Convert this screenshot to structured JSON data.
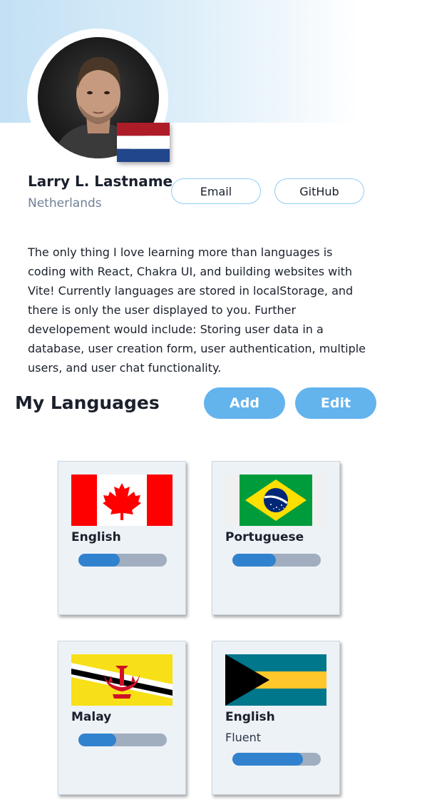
{
  "profile": {
    "name": "Larry L. Lastname",
    "country": "Netherlands",
    "country_flag": "netherlands-flag",
    "avatar": "profile-photo",
    "bio": "The only thing I love learning more than languages is coding with React, Chakra UI, and building websites with Vite! Currently languages are stored in localStorage, and there is only the user displayed to you. Further developement would include: Storing user data in a database, user creation form, user authentication, multiple users, and user chat functionality.",
    "buttons": {
      "email_label": "Email",
      "github_label": "GitHub"
    }
  },
  "languages_section": {
    "title": "My Languages",
    "add_label": "Add",
    "edit_label": "Edit"
  },
  "languages": [
    {
      "name": "English",
      "flag": "canada-flag",
      "level": "",
      "progress": 0.47
    },
    {
      "name": "Portuguese",
      "flag": "brazil-flag",
      "level": "",
      "progress": 0.49
    },
    {
      "name": "Malay",
      "flag": "brunei-flag",
      "level": "",
      "progress": 0.43
    },
    {
      "name": "English",
      "flag": "bahamas-flag",
      "level": "Fluent",
      "progress": 0.8
    }
  ],
  "colors": {
    "accent": "#63b3ed",
    "outline": "#90cdf4",
    "progress_fill": "#3182ce",
    "progress_track": "#a0aec0",
    "card_bg": "#edf2f7"
  }
}
